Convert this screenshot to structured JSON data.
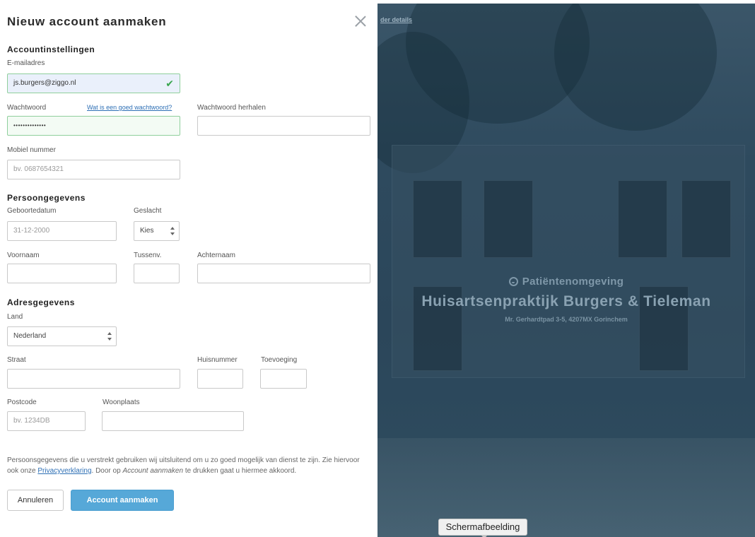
{
  "modal": {
    "title": "Nieuw account aanmaken",
    "close_icon": "close-icon"
  },
  "account": {
    "section_title": "Accountinstellingen",
    "email_label": "E-mailadres",
    "email_value": "js.burgers@ziggo.nl",
    "password_label": "Wachtwoord",
    "password_help_link": "Wat is een goed wachtwoord?",
    "password_value": "••••••••••••••",
    "password_repeat_label": "Wachtwoord herhalen",
    "password_repeat_value": "",
    "mobile_label": "Mobiel nummer",
    "mobile_placeholder": "bv. 0687654321"
  },
  "personal": {
    "section_title": "Persoongegevens",
    "birthdate_label": "Geboortedatum",
    "birthdate_placeholder": "31-12-2000",
    "gender_label": "Geslacht",
    "gender_value": "Kies",
    "firstname_label": "Voornaam",
    "infix_label": "Tussenv.",
    "lastname_label": "Achternaam"
  },
  "address": {
    "section_title": "Adresgegevens",
    "country_label": "Land",
    "country_value": "Nederland",
    "street_label": "Straat",
    "housenumber_label": "Huisnummer",
    "addition_label": "Toevoeging",
    "postcode_label": "Postcode",
    "postcode_placeholder": "bv. 1234DB",
    "city_label": "Woonplaats"
  },
  "notice": {
    "part1": "Persoonsgegevens die u verstrekt gebruiken wij uitsluitend om u zo goed mogelijk van dienst te zijn. Zie hiervoor ook onze ",
    "privacy_link": "Privacyverklaring",
    "part2": ". Door op ",
    "action_italic": "Account aanmaken",
    "part3": " te drukken gaat u hiermee akkoord."
  },
  "buttons": {
    "cancel": "Annuleren",
    "submit": "Account aanmaken"
  },
  "background": {
    "top_link": "der details",
    "subtitle": "Patiëntenomgeving",
    "practice_name": "Huisartsenpraktijk Burgers & Tieleman",
    "address_line": "Mr. Gerhardtpad 3-5, 4207MX Gorinchem"
  },
  "tooltip": {
    "label": "Schermafbeelding"
  },
  "colors": {
    "primary_button": "#56a8d8",
    "valid_border": "#8fcf9c",
    "valid_check": "#3aa64f",
    "link": "#2d6fb5",
    "background_overlay": "#2f4b5f"
  }
}
